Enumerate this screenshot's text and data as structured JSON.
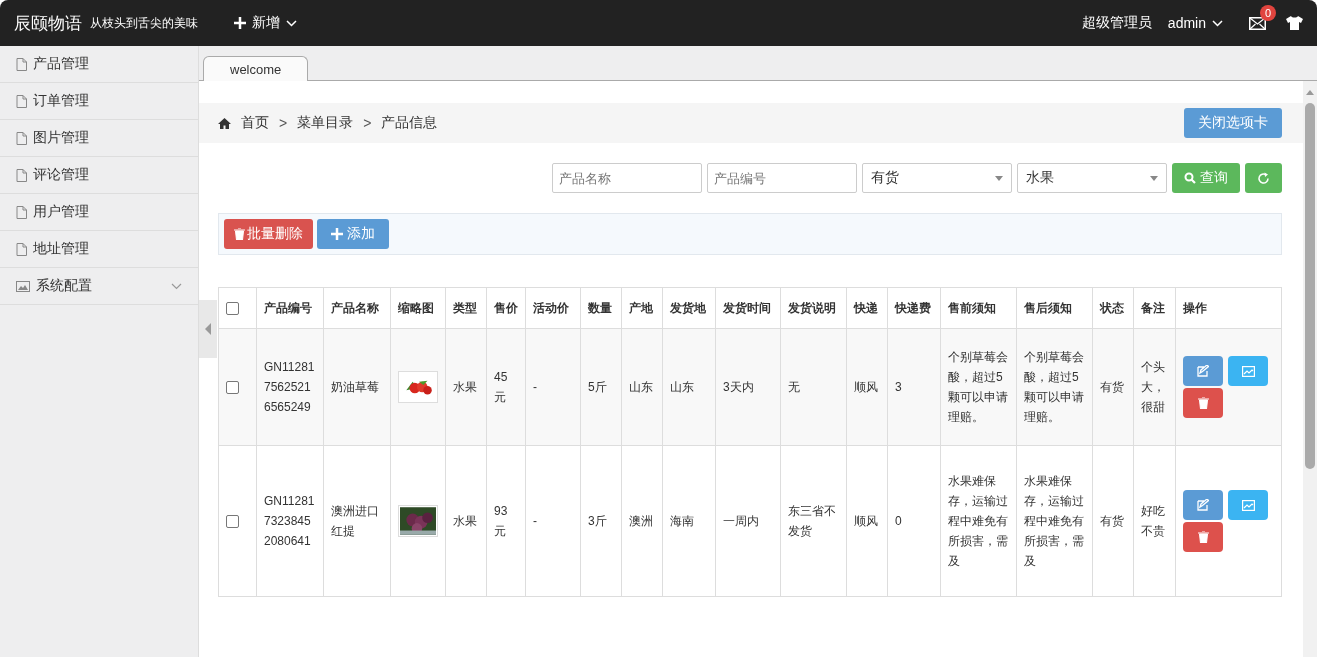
{
  "header": {
    "logo": "辰颐物语",
    "slogan": "从枝头到舌尖的美味",
    "new_menu": "新增",
    "role": "超级管理员",
    "user": "admin",
    "mail_badge": "0"
  },
  "sidebar": {
    "items": [
      {
        "label": "产品管理",
        "kind": "page"
      },
      {
        "label": "订单管理",
        "kind": "page"
      },
      {
        "label": "图片管理",
        "kind": "page"
      },
      {
        "label": "评论管理",
        "kind": "page"
      },
      {
        "label": "用户管理",
        "kind": "page"
      },
      {
        "label": "地址管理",
        "kind": "page"
      },
      {
        "label": "系统配置",
        "kind": "group",
        "expanded": false
      }
    ]
  },
  "tabs": [
    {
      "label": "welcome",
      "selected": true
    }
  ],
  "breadcrumb": {
    "items": [
      "首页",
      "菜单目录",
      "产品信息"
    ],
    "separator": ">"
  },
  "close_tab_button": "关闭选项卡",
  "filters": {
    "name_placeholder": "产品名称",
    "code_placeholder": "产品编号",
    "status": "有货",
    "category": "水果",
    "search_button": "查询"
  },
  "toolbar": {
    "batch_delete": "批量删除",
    "add": "添加"
  },
  "table": {
    "all_checked": false,
    "columns": [
      "产品编号",
      "产品名称",
      "缩略图",
      "类型",
      "售价",
      "活动价",
      "数量",
      "产地",
      "发货地",
      "发货时间",
      "发货说明",
      "快递",
      "快递费",
      "售前须知",
      "售后须知",
      "状态",
      "备注",
      "操作"
    ],
    "rows": [
      {
        "checked": false,
        "code": "GN1128175625216565249",
        "name": "奶油草莓",
        "type": "水果",
        "price": "45元",
        "promo": "-",
        "qty": "5斤",
        "origin": "山东",
        "ship_from": "山东",
        "ship_time": "3天内",
        "ship_note": "无",
        "courier": "顺风",
        "fee": "3",
        "pre_sale": "个别草莓会酸，超过5颗可以申请理赔。",
        "after_sale": "个别草莓会酸，超过5颗可以申请理赔。",
        "status": "有货",
        "remark": "个头大，很甜"
      },
      {
        "checked": false,
        "code": "GN1128173238452080641",
        "name": "澳洲进口红提",
        "type": "水果",
        "price": "93元",
        "promo": "-",
        "qty": "3斤",
        "origin": "澳洲",
        "ship_from": "海南",
        "ship_time": "一周内",
        "ship_note": "东三省不发货",
        "courier": "顺风",
        "fee": "0",
        "pre_sale": "水果难保存，运输过程中难免有所损害，需及",
        "after_sale": "水果难保存，运输过程中难免有所损害，需及",
        "status": "有货",
        "remark": "好吃不贵"
      }
    ]
  }
}
